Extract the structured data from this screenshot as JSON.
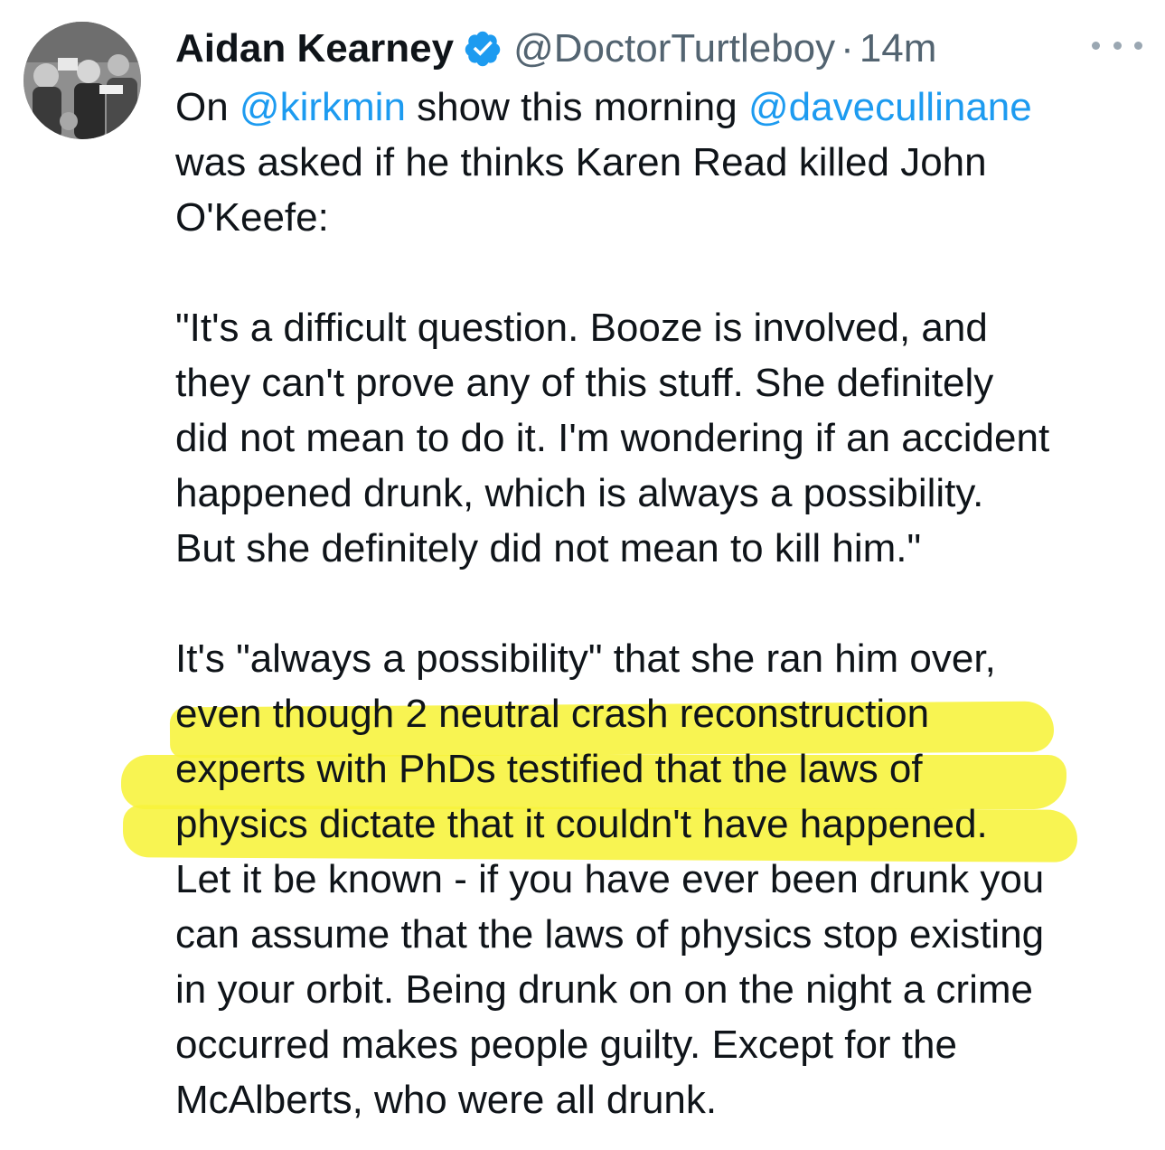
{
  "author": {
    "name": "Aidan Kearney",
    "handle": "@DoctorTurtleboy",
    "separator": "·",
    "time": "14m",
    "verified_icon": "verified-badge-icon",
    "verified_color": "#1d9bf0"
  },
  "more_icon": "more-options-icon",
  "tweet": {
    "line1": {
      "pre": "On ",
      "mention1": "@kirkmin",
      "mid": " show this morning ",
      "mention2": "@davecullinane"
    },
    "line2": "was asked if he thinks Karen Read killed John",
    "line3": "O'Keefe:",
    "quote": [
      "\"It's a difficult question. Booze is involved, and",
      "they can't prove any of this stuff. She definitely",
      "did not mean to do it. I'm wondering if an accident",
      "happened drunk, which is always a possibility.",
      "But she definitely did not mean to kill him.\""
    ],
    "closing": [
      "It's \"always a possibility\" that she ran him over,",
      "even though 2 neutral crash reconstruction",
      "experts with PhDs testified that the laws of",
      "physics dictate that it couldn't have happened.",
      "Let it be known - if you have ever been drunk you",
      "can assume that the laws of physics stop existing",
      "in your orbit. Being drunk on on the night a crime",
      "occurred makes people guilty. Except for the",
      "McAlberts, who were all drunk."
    ]
  },
  "colors": {
    "text": "#0f1419",
    "secondary": "#536471",
    "mention": "#1d9bf0",
    "highlight": "#f7f33a"
  }
}
